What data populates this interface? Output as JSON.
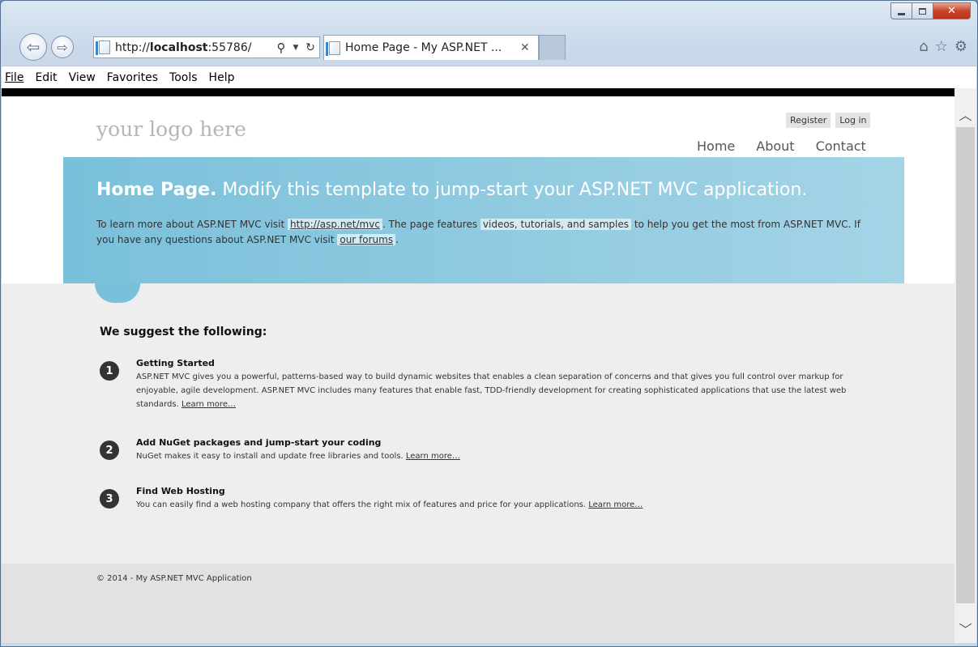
{
  "browser": {
    "address_prefix": "http://",
    "address_host": "localhost",
    "address_suffix": ":55786/",
    "tab_title": "Home Page - My ASP.NET ...",
    "menu": {
      "file": "File",
      "edit": "Edit",
      "view": "View",
      "favorites": "Favorites",
      "tools": "Tools",
      "help": "Help"
    }
  },
  "page": {
    "logo": "your logo here",
    "register": "Register",
    "login": "Log in",
    "nav": [
      "Home",
      "About",
      "Contact"
    ],
    "hero": {
      "title_bold": "Home Page.",
      "title_rest": " Modify this template to jump-start your ASP.NET MVC application.",
      "text_1": "To learn more about ASP.NET MVC visit ",
      "link_1": "http://asp.net/mvc",
      "text_2": ". The page features ",
      "highlight": "videos, tutorials, and samples",
      "text_3": " to help you get the most from ASP.NET MVC. If you have any questions about ASP.NET MVC visit ",
      "link_2": "our forums",
      "text_4": "."
    },
    "suggest_heading": "We suggest the following:",
    "steps": [
      {
        "number": "1",
        "title": "Getting Started",
        "text": "ASP.NET MVC gives you a powerful, patterns-based way to build dynamic websites that enables a clean separation of concerns and that gives you full control over markup for enjoyable, agile development. ASP.NET MVC includes many features that enable fast, TDD-friendly development for creating sophisticated applications that use the latest web standards. ",
        "link": "Learn more…"
      },
      {
        "number": "2",
        "title": "Add NuGet packages and jump-start your coding",
        "text": "NuGet makes it easy to install and update free libraries and tools. ",
        "link": "Learn more…"
      },
      {
        "number": "3",
        "title": "Find Web Hosting",
        "text": "You can easily find a web hosting company that offers the right mix of features and price for your applications. ",
        "link": "Learn more…"
      }
    ],
    "footer": "© 2014 - My ASP.NET MVC Application"
  },
  "colors": {
    "featured_start": "#7ac0da",
    "featured_end": "#a4d4e6",
    "content_bg": "#efeeef",
    "footer_bg": "#e2e2e2"
  }
}
